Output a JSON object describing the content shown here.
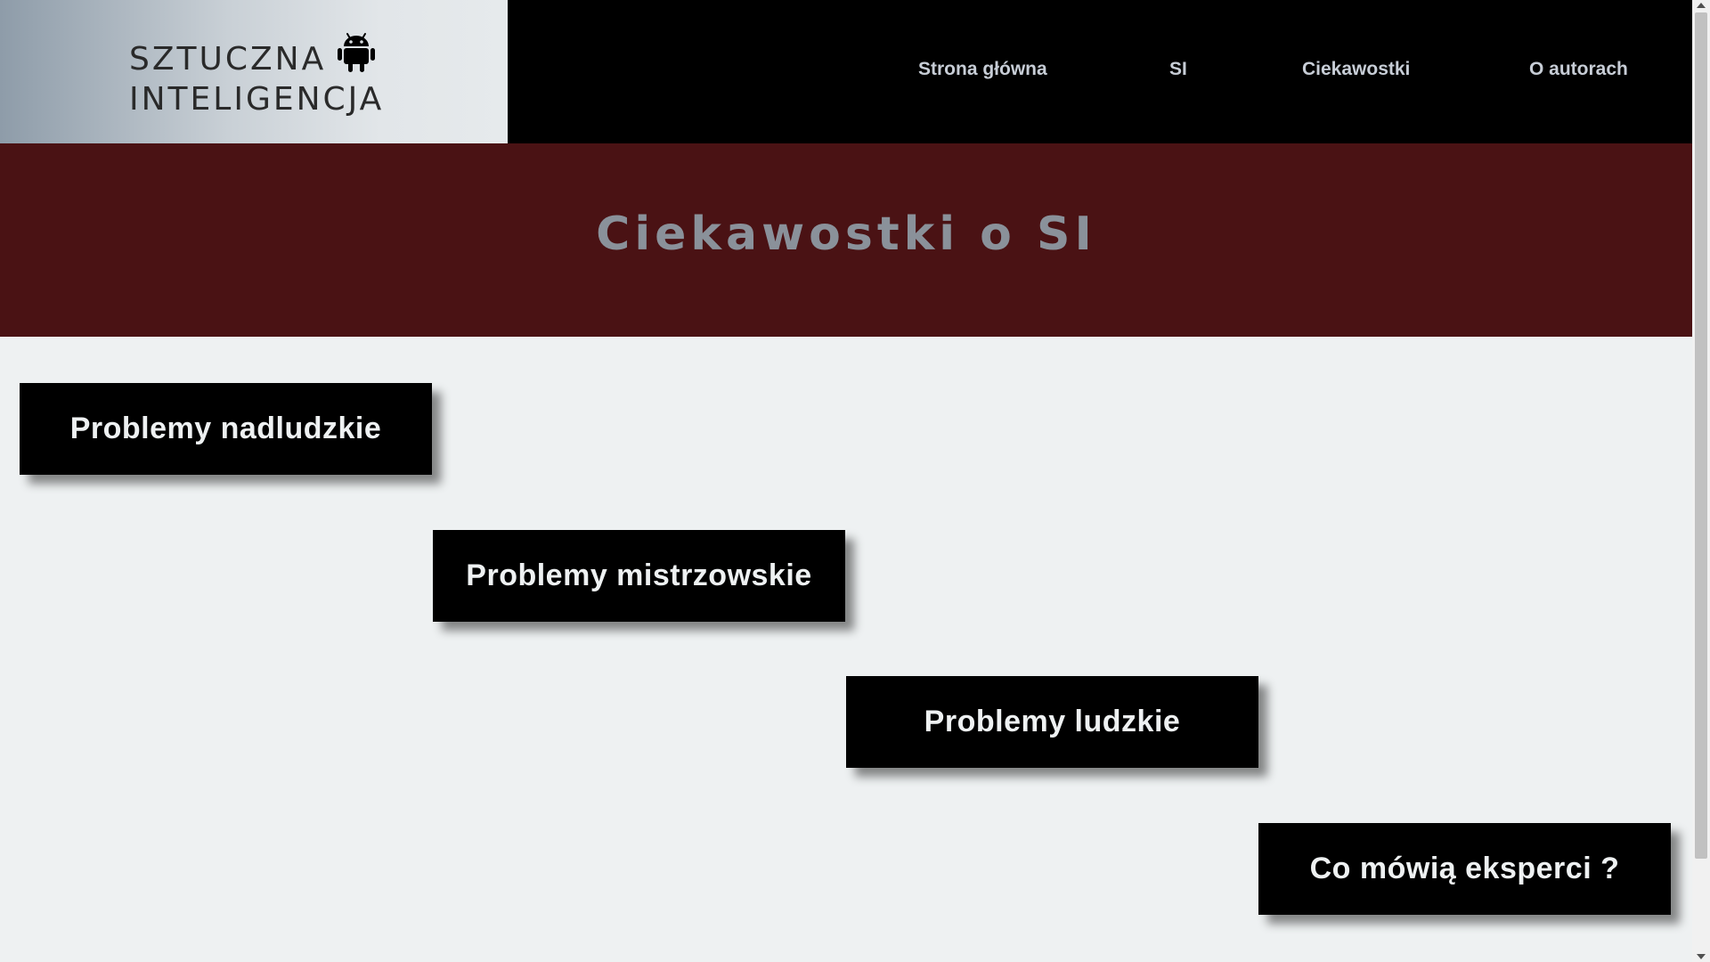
{
  "brand": {
    "line1": "SZTUCZNA",
    "line2": "INTELIGENCJA",
    "icon": "android-icon"
  },
  "nav": {
    "items": [
      {
        "label": "Strona główna"
      },
      {
        "label": "SI"
      },
      {
        "label": "Ciekawostki"
      },
      {
        "label": "O autorach"
      }
    ]
  },
  "banner": {
    "title": "Ciekawostki o SI"
  },
  "cards": [
    {
      "label": "Problemy nadludzkie"
    },
    {
      "label": "Problemy mistrzowskie"
    },
    {
      "label": "Problemy ludzkie"
    },
    {
      "label": "Co mówią eksperci ?"
    }
  ],
  "colors": {
    "header_bg": "#000000",
    "banner_bg": "#4a1214",
    "banner_text": "#8a919a",
    "nav_text": "#c7cdd6",
    "page_bg": "#eef1f2",
    "card_bg": "#000000",
    "card_text": "#eef1f2"
  }
}
